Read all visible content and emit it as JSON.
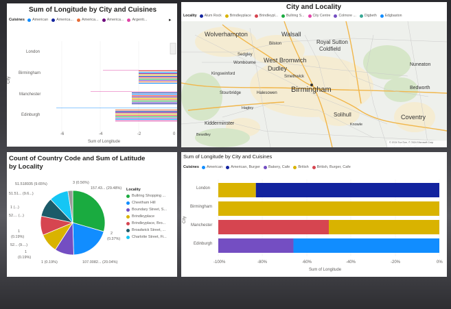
{
  "panels": {
    "top_left": {
      "title": "Sum of Longitude by City and Cuisines",
      "legend_label": "Cuisines",
      "legend": [
        {
          "name": "American",
          "color": "#118DFF"
        },
        {
          "name": "America...",
          "color": "#12239E"
        },
        {
          "name": "America...",
          "color": "#E66C37"
        },
        {
          "name": "America...",
          "color": "#6B007B"
        },
        {
          "name": "Argenti...",
          "color": "#E044A7"
        }
      ],
      "ylabel": "City",
      "xlabel": "Sum of Longitude",
      "categories": [
        "London",
        "Birmingham",
        "Manchester",
        "Edinburgh"
      ],
      "xticks": [
        "-6",
        "-4",
        "-2",
        "0"
      ]
    },
    "top_right": {
      "title": "City and Locality",
      "legend_label": "Locality",
      "legend": [
        {
          "name": "Alum Rock",
          "color": "#12239E"
        },
        {
          "name": "Brindleyplace",
          "color": "#D9B300"
        },
        {
          "name": "Brindleypl...",
          "color": "#D64550"
        },
        {
          "name": "Bullring S...",
          "color": "#1AAB40"
        },
        {
          "name": "City Centre",
          "color": "#E044A7"
        },
        {
          "name": "Colmore ...",
          "color": "#744EC2"
        },
        {
          "name": "Digbeth",
          "color": "#37A794"
        },
        {
          "name": "Edgbaston",
          "color": "#118DFF"
        }
      ],
      "towns": [
        {
          "name": "Wolverhampton",
          "size": 9
        },
        {
          "name": "Walsall",
          "size": 9
        },
        {
          "name": "Royal Sutton",
          "size": 8
        },
        {
          "name": "Coldfield",
          "size": 8
        },
        {
          "name": "Bilston",
          "size": 6
        },
        {
          "name": "Sedgley",
          "size": 6
        },
        {
          "name": "Wombourne",
          "size": 6
        },
        {
          "name": "West Bromwich",
          "size": 9
        },
        {
          "name": "Dudley",
          "size": 9
        },
        {
          "name": "Smethwick",
          "size": 6
        },
        {
          "name": "Kingswinford",
          "size": 6
        },
        {
          "name": "Birmingham",
          "size": 11
        },
        {
          "name": "Stourbridge",
          "size": 6
        },
        {
          "name": "Halesowen",
          "size": 6
        },
        {
          "name": "Hagley",
          "size": 5.5
        },
        {
          "name": "Kidderminster",
          "size": 7
        },
        {
          "name": "Bewdley",
          "size": 5.5
        },
        {
          "name": "Solihull",
          "size": 8
        },
        {
          "name": "Knowle",
          "size": 5.5
        },
        {
          "name": "Coventry",
          "size": 9
        },
        {
          "name": "Nuneaton",
          "size": 7
        },
        {
          "name": "Bedworth",
          "size": 7
        }
      ],
      "attribution": "© 2024 TomTom, © 2024 Microsoft Corp"
    },
    "bottom_left": {
      "title_line1": "Count of Country Code and Sum of Latitude",
      "title_line2": "by Locality",
      "legend_label": "Locality",
      "legend": [
        {
          "name": "Bullring Shopping ...",
          "color": "#1AAB40"
        },
        {
          "name": "Cheetham Hill",
          "color": "#118DFF"
        },
        {
          "name": "Boundary Street, S...",
          "color": "#744EC2"
        },
        {
          "name": "Brindleyplace",
          "color": "#D9B300"
        },
        {
          "name": "Brindleyplace, Bro...",
          "color": "#D64550"
        },
        {
          "name": "Broadwick Street, ...",
          "color": "#1C5B69"
        },
        {
          "name": "Charlotte Street, Fi...",
          "color": "#15C6F4"
        }
      ],
      "pie_labels": [
        "51.518935 (9.65%)",
        "51.51... (9.6...)",
        "1 (...)",
        "52.... (...)",
        "1",
        "(0.19%)",
        "52... (9....)",
        "1",
        "(0.19%)",
        "1 (0.19%)",
        "107.0082... (20.04%)",
        "2",
        "(0.37%)",
        "157.43... (29.48%)",
        "3 (0.56%)"
      ]
    },
    "bottom_right": {
      "title": "Sum of Longitude by City and Cuisines",
      "legend_label": "Cuisines",
      "legend": [
        {
          "name": "American",
          "color": "#118DFF"
        },
        {
          "name": "American, Burger",
          "color": "#12239E"
        },
        {
          "name": "Bakery, Cafe",
          "color": "#744EC2"
        },
        {
          "name": "British",
          "color": "#D9B300"
        },
        {
          "name": "British, Burger, Cafe",
          "color": "#D64550"
        }
      ],
      "ylabel": "City",
      "xlabel": "Sum of Longitude",
      "categories": [
        "London",
        "Birmingham",
        "Manchester",
        "Edinburgh"
      ],
      "xticks": [
        "-100%",
        "-80%",
        "-60%",
        "-40%",
        "-20%",
        "0%"
      ]
    }
  },
  "chart_data": [
    {
      "type": "bar",
      "title": "Sum of Longitude by City and Cuisines",
      "orientation": "horizontal",
      "categories": [
        "London",
        "Birmingham",
        "Manchester",
        "Edinburgh"
      ],
      "xlabel": "Sum of Longitude",
      "ylabel": "City",
      "xlim": [
        -7,
        0
      ],
      "values_approx": [
        0.0,
        -2.0,
        -4.5,
        -6.0
      ]
    },
    {
      "type": "pie",
      "title": "Count of Country Code and Sum of Latitude by Locality",
      "slices": [
        {
          "name": "Bullring Shopping ...",
          "percent": 29.48,
          "color": "#1AAB40"
        },
        {
          "name": "Cheetham Hill",
          "percent": 20.04,
          "color": "#118DFF"
        },
        {
          "name": "Boundary Street, S...",
          "percent": 9.6,
          "color": "#744EC2"
        },
        {
          "name": "Brindleyplace",
          "percent": 9.6,
          "color": "#D9B300"
        },
        {
          "name": "Brindleyplace, Bro...",
          "percent": 9.6,
          "color": "#D64550"
        },
        {
          "name": "Broadwick Street, ...",
          "percent": 9.6,
          "color": "#1C5B69"
        },
        {
          "name": "Charlotte Street, Fi...",
          "percent": 9.65,
          "color": "#15C6F4"
        },
        {
          "name": "other",
          "percent": 2.43,
          "color": "#999999"
        }
      ]
    },
    {
      "type": "bar",
      "stacked": "100%",
      "orientation": "horizontal",
      "title": "Sum of Longitude by City and Cuisines",
      "categories": [
        "London",
        "Birmingham",
        "Manchester",
        "Edinburgh"
      ],
      "xlabel": "Sum of Longitude",
      "ylabel": "City",
      "xlim": [
        -100,
        0
      ],
      "series": [
        {
          "name": "American",
          "values": [
            0,
            0,
            0,
            66
          ]
        },
        {
          "name": "American, Burger",
          "values": [
            83,
            0,
            0,
            0
          ]
        },
        {
          "name": "Bakery, Cafe",
          "values": [
            0,
            0,
            0,
            34
          ]
        },
        {
          "name": "British",
          "values": [
            17,
            100,
            50,
            0
          ]
        },
        {
          "name": "British, Burger, Cafe",
          "values": [
            0,
            0,
            50,
            0
          ]
        }
      ]
    }
  ]
}
